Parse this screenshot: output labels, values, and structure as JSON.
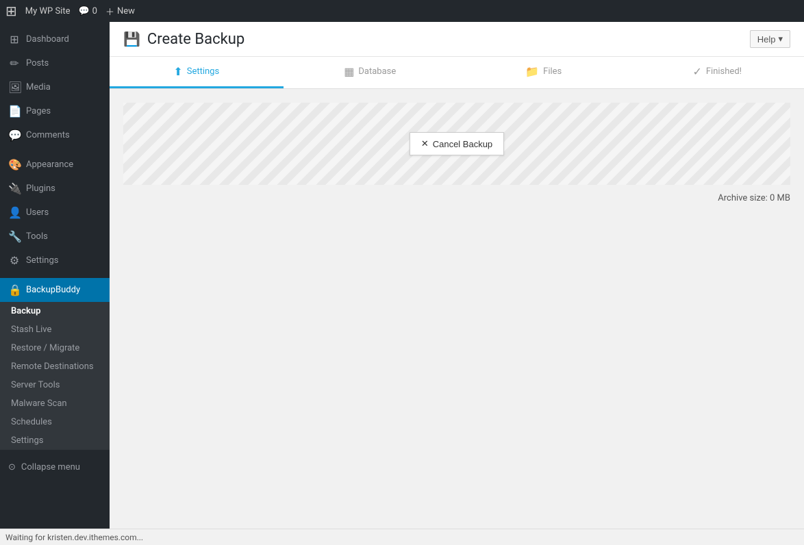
{
  "adminbar": {
    "logo": "⊞",
    "site_name": "My WP Site",
    "comments_label": "0",
    "new_label": "New"
  },
  "sidebar": {
    "items": [
      {
        "id": "dashboard",
        "label": "Dashboard",
        "icon": "⊞"
      },
      {
        "id": "posts",
        "label": "Posts",
        "icon": "📝"
      },
      {
        "id": "media",
        "label": "Media",
        "icon": "🖼"
      },
      {
        "id": "pages",
        "label": "Pages",
        "icon": "📄"
      },
      {
        "id": "comments",
        "label": "Comments",
        "icon": "💬"
      },
      {
        "id": "appearance",
        "label": "Appearance",
        "icon": "🎨"
      },
      {
        "id": "plugins",
        "label": "Plugins",
        "icon": "🔌"
      },
      {
        "id": "users",
        "label": "Users",
        "icon": "👤"
      },
      {
        "id": "tools",
        "label": "Tools",
        "icon": "🔧"
      },
      {
        "id": "settings",
        "label": "Settings",
        "icon": "⚙"
      },
      {
        "id": "backupbuddy",
        "label": "BackupBuddy",
        "icon": "🔒"
      }
    ],
    "submenu": [
      {
        "id": "backup",
        "label": "Backup",
        "active": true
      },
      {
        "id": "stash-live",
        "label": "Stash Live"
      },
      {
        "id": "restore-migrate",
        "label": "Restore / Migrate"
      },
      {
        "id": "remote-destinations",
        "label": "Remote Destinations"
      },
      {
        "id": "server-tools",
        "label": "Server Tools"
      },
      {
        "id": "malware-scan",
        "label": "Malware Scan"
      },
      {
        "id": "schedules",
        "label": "Schedules"
      },
      {
        "id": "settings-sub",
        "label": "Settings"
      }
    ],
    "collapse_label": "Collapse menu"
  },
  "page": {
    "icon": "💾",
    "title": "Create Backup",
    "help_label": "Help"
  },
  "tabs": [
    {
      "id": "settings",
      "label": "Settings",
      "icon": "⬆",
      "active": true
    },
    {
      "id": "database",
      "label": "Database",
      "icon": "▦"
    },
    {
      "id": "files",
      "label": "Files",
      "icon": "📁"
    },
    {
      "id": "finished",
      "label": "Finished!",
      "icon": "✓"
    }
  ],
  "content": {
    "cancel_backup_label": "Cancel Backup",
    "archive_label": "Archive size:",
    "archive_value": "0 MB"
  },
  "statusbar": {
    "text": "Waiting for kristen.dev.ithemes.com..."
  }
}
